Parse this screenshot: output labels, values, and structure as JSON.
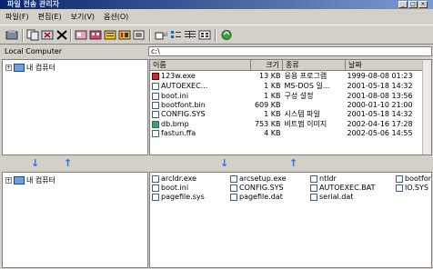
{
  "window": {
    "title": "파일 전송 관리자"
  },
  "menu": [
    "파일(F)",
    "편집(E)",
    "보기(V)",
    "옵션(O)"
  ],
  "toolbar": {
    "icons": [
      "disconnect-icon",
      "copy-icon",
      "cut-icon",
      "delete-icon",
      "view-large-icon",
      "view-small-icon",
      "view-list-icon",
      "view-detail-icon",
      "properties-icon",
      "folder-up-icon",
      "new-folder-icon",
      "details-icon",
      "refresh-icon"
    ]
  },
  "local": {
    "label": "Local Computer",
    "tree_label": "내 컴퓨터"
  },
  "remote": {
    "address": "c:\\",
    "columns": [
      "이름",
      "크기",
      "종류",
      "날짜"
    ],
    "files": [
      {
        "name": "123w.exe",
        "size": "13 KB",
        "type": "응용 프로그램",
        "date": "1999-08-08 01:23",
        "icon": "exe"
      },
      {
        "name": "AUTOEXEC...",
        "size": "1 KB",
        "type": "MS-DOS 일...",
        "date": "2001-05-18 14:32",
        "icon": "file"
      },
      {
        "name": "boot.ini",
        "size": "1 KB",
        "type": "구성 설정",
        "date": "2001-08-08 13:56",
        "icon": "file"
      },
      {
        "name": "bootfont.bin",
        "size": "609 KB",
        "type": "",
        "date": "2000-01-10 21:00",
        "icon": "file"
      },
      {
        "name": "CONFIG.SYS",
        "size": "1 KB",
        "type": "시스템 파일",
        "date": "2001-05-18 14:32",
        "icon": "file"
      },
      {
        "name": "db.bmp",
        "size": "753 KB",
        "type": "비트맵 이미지",
        "date": "2002-04-16 17:28",
        "icon": "img"
      },
      {
        "name": "fastun.ffa",
        "size": "4 KB",
        "type": "",
        "date": "2002-05-06 14:55",
        "icon": "file"
      }
    ]
  },
  "bottom": {
    "tree_label": "내 컴퓨터",
    "files": [
      "arcldr.exe",
      "arcsetup.exe",
      "ntldr",
      "bootfont",
      "boot.ini",
      "CONFIG.SYS",
      "AUTOEXEC.BAT",
      "IO.SYS",
      "pagefile.sys",
      "pagefile.dat",
      "serial.dat"
    ]
  }
}
